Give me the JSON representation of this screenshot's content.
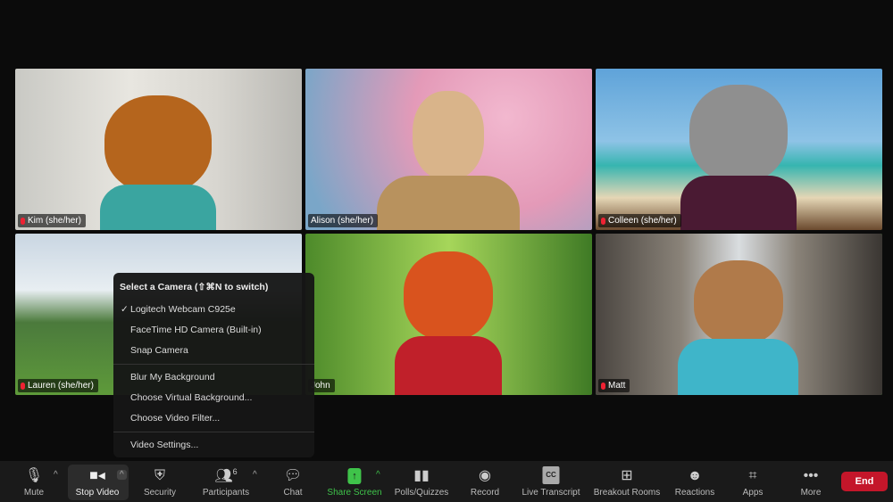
{
  "participants": [
    {
      "name": "Kim (she/her)",
      "muted": true
    },
    {
      "name": "Alison (she/her)",
      "muted": false
    },
    {
      "name": "Colleen (she/her)",
      "muted": true
    },
    {
      "name": "Lauren (she/her)",
      "muted": true
    },
    {
      "name": "John",
      "muted": false
    },
    {
      "name": "Matt",
      "muted": true,
      "active_speaker": true
    }
  ],
  "camera_menu": {
    "header": "Select a Camera (⇧⌘N to switch)",
    "cameras": [
      {
        "label": "Logitech Webcam C925e",
        "checked": true
      },
      {
        "label": "FaceTime HD Camera (Built-in)",
        "checked": false
      },
      {
        "label": "Snap Camera",
        "checked": false
      }
    ],
    "background": [
      "Blur My Background",
      "Choose Virtual Background...",
      "Choose Video Filter..."
    ],
    "settings": "Video Settings..."
  },
  "toolbar": {
    "mute": "Mute",
    "stop_video": "Stop Video",
    "security": "Security",
    "participants": "Participants",
    "participants_count": "6",
    "chat": "Chat",
    "share_screen": "Share Screen",
    "polls": "Polls/Quizzes",
    "record": "Record",
    "live_transcript": "Live Transcript",
    "cc": "CC",
    "breakout_rooms": "Breakout Rooms",
    "reactions": "Reactions",
    "apps": "Apps",
    "more": "More",
    "end": "End"
  },
  "colors": {
    "share_green": "#3fc34a",
    "end_red": "#c4162a",
    "active_border": "#3fbf3f"
  }
}
